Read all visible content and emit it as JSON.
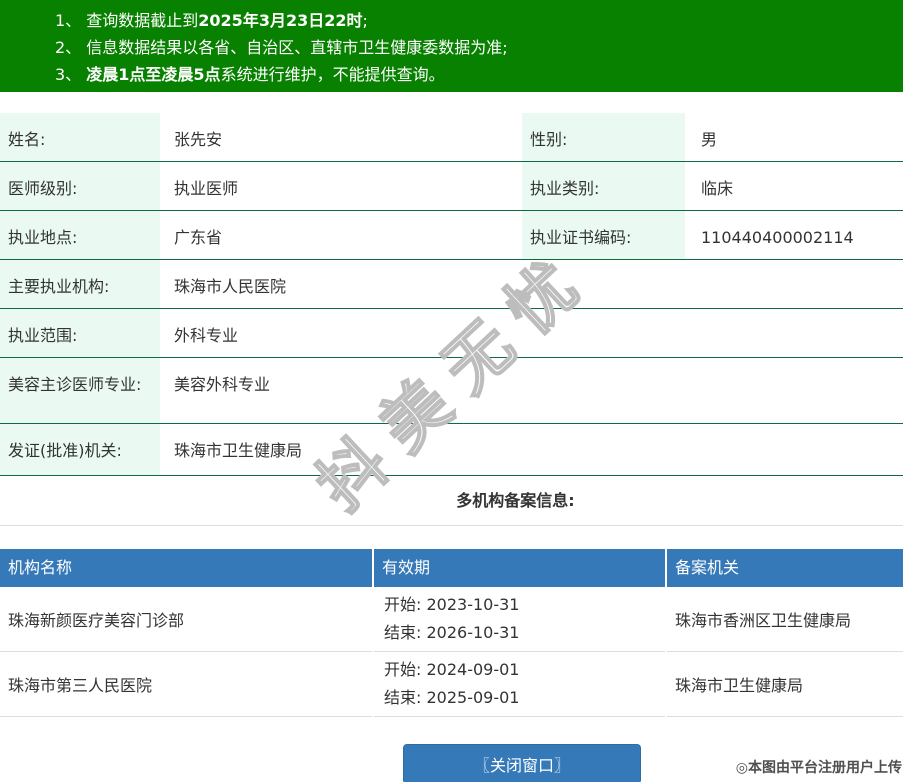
{
  "colors": {
    "banner_green": "#088000",
    "header_blue": "#3579b8",
    "label_bg": "#eafaf2",
    "border_green": "#0c6b40",
    "button_blue": "#3579b8"
  },
  "banner": {
    "lines": [
      {
        "pre": "1、 查询数据截止到",
        "bold": "2025年3月23日22时",
        "post": ";"
      },
      {
        "pre": "2、 信息数据结果以各省、自治区、直辖市卫生健康委数据为准;",
        "bold": "",
        "post": ""
      },
      {
        "pre": "3、 ",
        "bold": "凌晨1点至凌晨5点",
        "post": "系统进行维护，不能提供查询。"
      }
    ]
  },
  "info": {
    "rows": [
      {
        "cells": [
          {
            "label": "姓名:",
            "value": "张先安"
          },
          {
            "label": "性别:",
            "value": "男"
          }
        ]
      },
      {
        "cells": [
          {
            "label": "医师级别:",
            "value": "执业医师"
          },
          {
            "label": "执业类别:",
            "value": "临床"
          }
        ]
      },
      {
        "cells": [
          {
            "label": "执业地点:",
            "value": "广东省"
          },
          {
            "label": "执业证书编码:",
            "value": "110440400002114"
          }
        ]
      },
      {
        "label": "主要执业机构:",
        "value": "珠海市人民医院"
      },
      {
        "label": "执业范围:",
        "value": "外科专业"
      },
      {
        "label": "美容主诊医师专业:",
        "value": "美容外科专业"
      },
      {
        "label": "发证(批准)机关:",
        "value": "珠海市卫生健康局"
      }
    ]
  },
  "section": {
    "title": "多机构备案信息:"
  },
  "records": {
    "headers": [
      "机构名称",
      "有效期",
      "备案机关"
    ],
    "rows": [
      {
        "org": "珠海新颜医疗美容门诊部",
        "start": "开始: 2023-10-31",
        "end": "结束: 2026-10-31",
        "authority": "珠海市香洲区卫生健康局"
      },
      {
        "org": "珠海市第三人民医院",
        "start": "开始: 2024-09-01",
        "end": "结束: 2025-09-01",
        "authority": "珠海市卫生健康局"
      }
    ]
  },
  "watermark": {
    "text": "抖美无忧"
  },
  "button": {
    "label": "〖关闭窗口〗"
  },
  "footer": {
    "credit": "◎本图由平台注册用户上传"
  }
}
